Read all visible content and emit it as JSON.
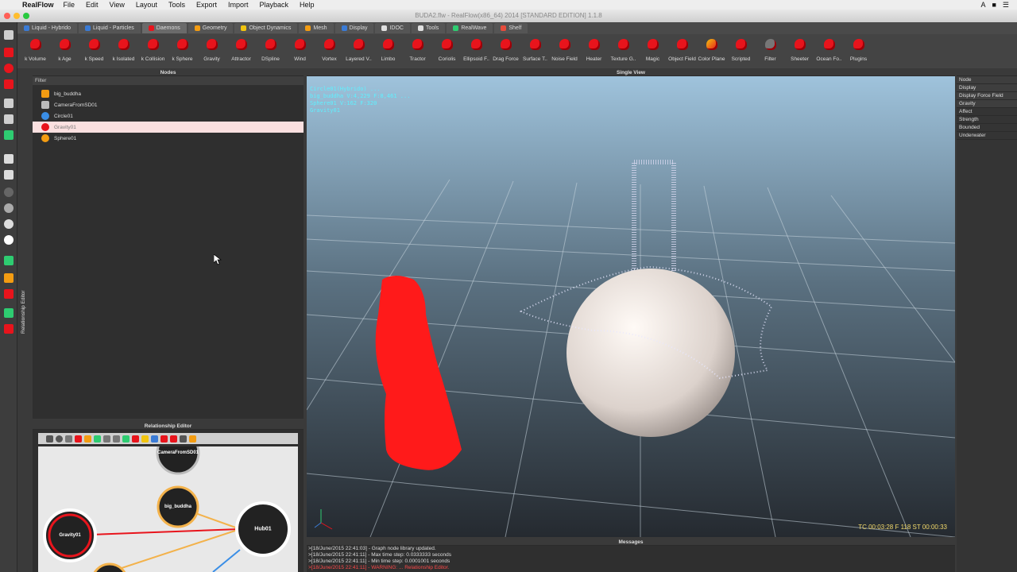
{
  "menubar": {
    "app": "RealFlow",
    "items": [
      "File",
      "Edit",
      "View",
      "Layout",
      "Tools",
      "Export",
      "Import",
      "Playback",
      "Help"
    ]
  },
  "window": {
    "title": "BUDA2.flw - RealFlow(x86_64) 2014 [STANDARD EDITION] 1.1.8"
  },
  "tabs": [
    {
      "label": "Liquid - Hybrido",
      "color": "#3a7bd5"
    },
    {
      "label": "Liquid - Particles",
      "color": "#3a7bd5"
    },
    {
      "label": "Daemons",
      "color": "#e8141c"
    },
    {
      "label": "Geometry",
      "color": "#f39c12"
    },
    {
      "label": "Object Dynamics",
      "color": "#f1c40f"
    },
    {
      "label": "Mesh",
      "color": "#f39c12"
    },
    {
      "label": "Display",
      "color": "#3a7bd5"
    },
    {
      "label": "IDOC",
      "color": "#e0e0e0"
    },
    {
      "label": "Tools",
      "color": "#e0e0e0"
    },
    {
      "label": "RealWave",
      "color": "#2ecc71"
    },
    {
      "label": "Shelf",
      "color": "#e74c3c"
    }
  ],
  "daemons": [
    "k Volume",
    "k Age",
    "k Speed",
    "k Isolated",
    "k Collision",
    "k Sphere",
    "Gravity",
    "Attractor",
    "DSpline",
    "Wind",
    "Vortex",
    "Layered V..",
    "Limbo",
    "Tractor",
    "Coriolis",
    "Ellipsoid F..",
    "Drag Force",
    "Surface T..",
    "Noise Field",
    "Heater",
    "Texture G..",
    "Magic",
    "Object Field",
    "Color Plane",
    "Scripted",
    "Filter",
    "Sheeter",
    "Ocean Fo..",
    "Plugins"
  ],
  "nodes_panel": {
    "title": "Nodes",
    "filter_label": "Filter",
    "items": [
      {
        "label": "big_buddha",
        "icon": "cube-icon",
        "color": "#f39c12"
      },
      {
        "label": "CameraFromSD01",
        "icon": "camera-icon",
        "color": "#bbbbbb"
      },
      {
        "label": "Circle01",
        "icon": "circle-icon",
        "color": "#3a8ee6"
      },
      {
        "label": "Gravity01",
        "icon": "gravity-icon",
        "color": "#e8141c"
      },
      {
        "label": "Sphere01",
        "icon": "sphere-icon",
        "color": "#f39c12"
      }
    ],
    "selected": "Gravity01"
  },
  "relationship_editor": {
    "title": "Relationship Editor",
    "vertical_label": "Relationship Editor",
    "nodes": {
      "camera": "CameraFromSD01",
      "buddha": "big_buddha",
      "hub": "Hub01",
      "gravity": "Gravity01"
    }
  },
  "viewport": {
    "title": "Single View",
    "hud_lines": [
      "Circle01(Hybrido) ... ",
      "big_buddha V:4,229 F:8,461 ...",
      "Sphere01 V:162 F:320",
      "Gravity01"
    ],
    "timecode": "TC 00:03:28   F 118   ST 00:00:33"
  },
  "messages": {
    "title": "Messages",
    "lines": [
      {
        "text": ">[18/June/2015 22:41:03] - Graph node library updated.",
        "warn": false
      },
      {
        "text": ">[18/June/2015 22:41:11] - Max time step: 0.0333333 seconds",
        "warn": false
      },
      {
        "text": ">[18/June/2015 22:41:11] - Min time step: 0.0001001 seconds",
        "warn": false
      },
      {
        "text": ">[18/June/2015 22:41:11] - WARNING: ... Relationship Editor.",
        "warn": true
      }
    ]
  },
  "properties": {
    "rows": [
      "Node",
      "Display",
      "Display Force Field",
      "Gravity",
      "Affect",
      "Strength",
      "Bounded",
      "Underwater"
    ]
  }
}
